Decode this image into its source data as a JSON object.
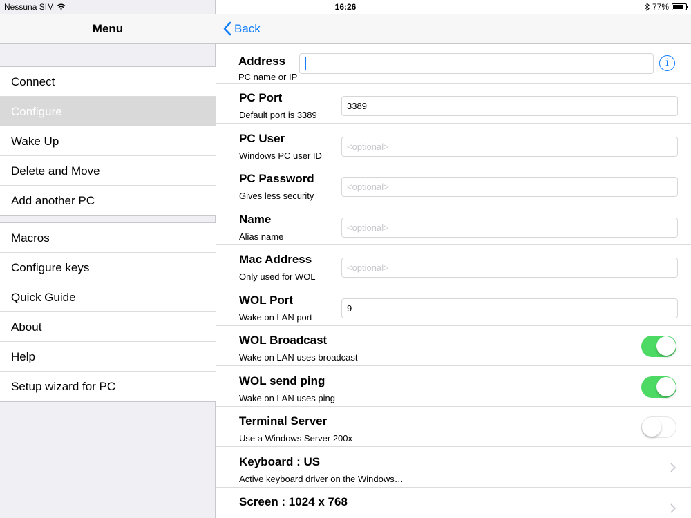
{
  "status": {
    "carrier": "Nessuna SIM",
    "time": "16:26",
    "battery": "77%",
    "battery_level": 0.77
  },
  "left_nav": {
    "title": "Menu"
  },
  "menu_group1": [
    {
      "label": "Connect",
      "selected": false
    },
    {
      "label": "Configure",
      "selected": true
    },
    {
      "label": "Wake Up",
      "selected": false
    },
    {
      "label": "Delete and Move",
      "selected": false
    },
    {
      "label": "Add another PC",
      "selected": false
    }
  ],
  "menu_group2": [
    {
      "label": "Macros"
    },
    {
      "label": "Configure keys"
    },
    {
      "label": "Quick Guide"
    },
    {
      "label": "About"
    },
    {
      "label": "Help"
    },
    {
      "label": "Setup wizard for PC"
    }
  ],
  "right_nav": {
    "back_label": "Back"
  },
  "form": {
    "address": {
      "label": "Address",
      "sub": "PC name or IP",
      "value": ""
    },
    "pc_port": {
      "label": "PC Port",
      "sub": "Default port is 3389",
      "value": "3389"
    },
    "pc_user": {
      "label": "PC User",
      "sub": "Windows PC user ID",
      "placeholder": "<optional>"
    },
    "pc_password": {
      "label": "PC Password",
      "sub": "Gives less security",
      "placeholder": "<optional>"
    },
    "name": {
      "label": "Name",
      "sub": "Alias name",
      "placeholder": "<optional>"
    },
    "mac_address": {
      "label": "Mac Address",
      "sub": "Only used for WOL",
      "placeholder": "<optional>"
    },
    "wol_port": {
      "label": "WOL Port",
      "sub": "Wake on LAN port",
      "value": "9"
    },
    "wol_broadcast": {
      "label": "WOL Broadcast",
      "sub": "Wake on LAN uses broadcast",
      "on": true
    },
    "wol_ping": {
      "label": "WOL send ping",
      "sub": "Wake on LAN uses ping",
      "on": true
    },
    "terminal_server": {
      "label": "Terminal Server",
      "sub": "Use a Windows Server 200x",
      "on": false
    },
    "keyboard": {
      "label": "Keyboard : US",
      "sub": "Active keyboard driver on the Windows…"
    },
    "screen": {
      "label": "Screen : 1024 x 768"
    }
  },
  "colors": {
    "accent": "#157efb",
    "toggle_on": "#4cd964",
    "selected_bg": "#d9d9d9"
  }
}
